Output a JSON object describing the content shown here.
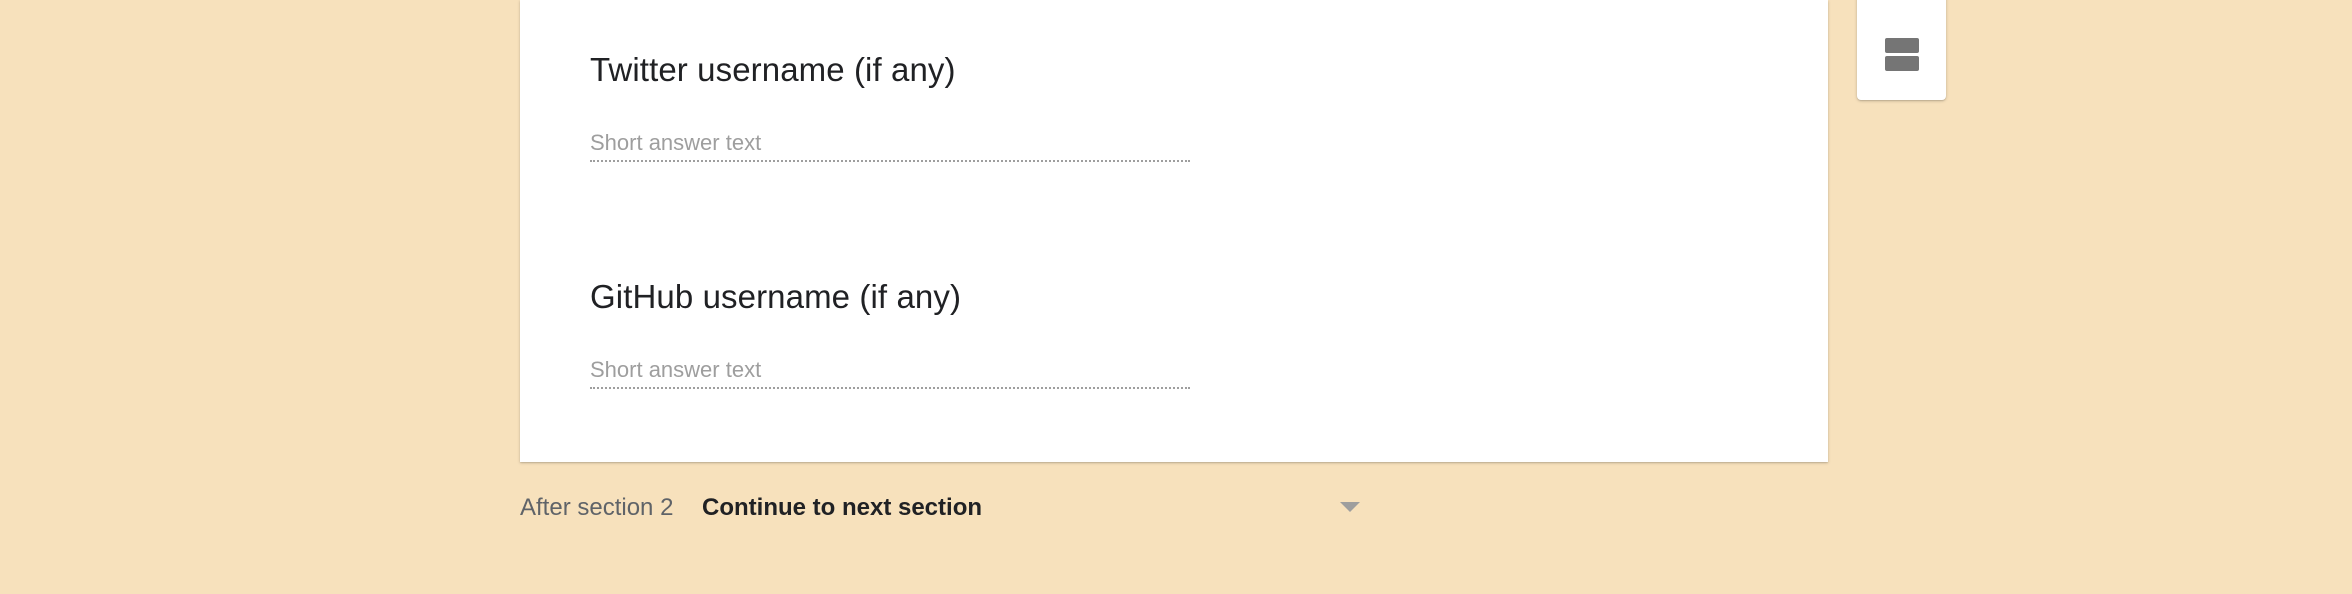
{
  "questions": [
    {
      "title": "Twitter username (if any)",
      "answer_placeholder": "Short answer text"
    },
    {
      "title": "GitHub username (if any)",
      "answer_placeholder": "Short answer text"
    }
  ],
  "toolbar": {
    "items": [
      {
        "icon": "partial-toolbar-icon"
      },
      {
        "icon": "add-section-icon"
      }
    ]
  },
  "section_navigation": {
    "label": "After section 2",
    "selected": "Continue to next section"
  },
  "colors": {
    "background": "#f7e1bc",
    "card": "#ffffff",
    "placeholder": "#9e9e9e",
    "icon": "#757575"
  }
}
